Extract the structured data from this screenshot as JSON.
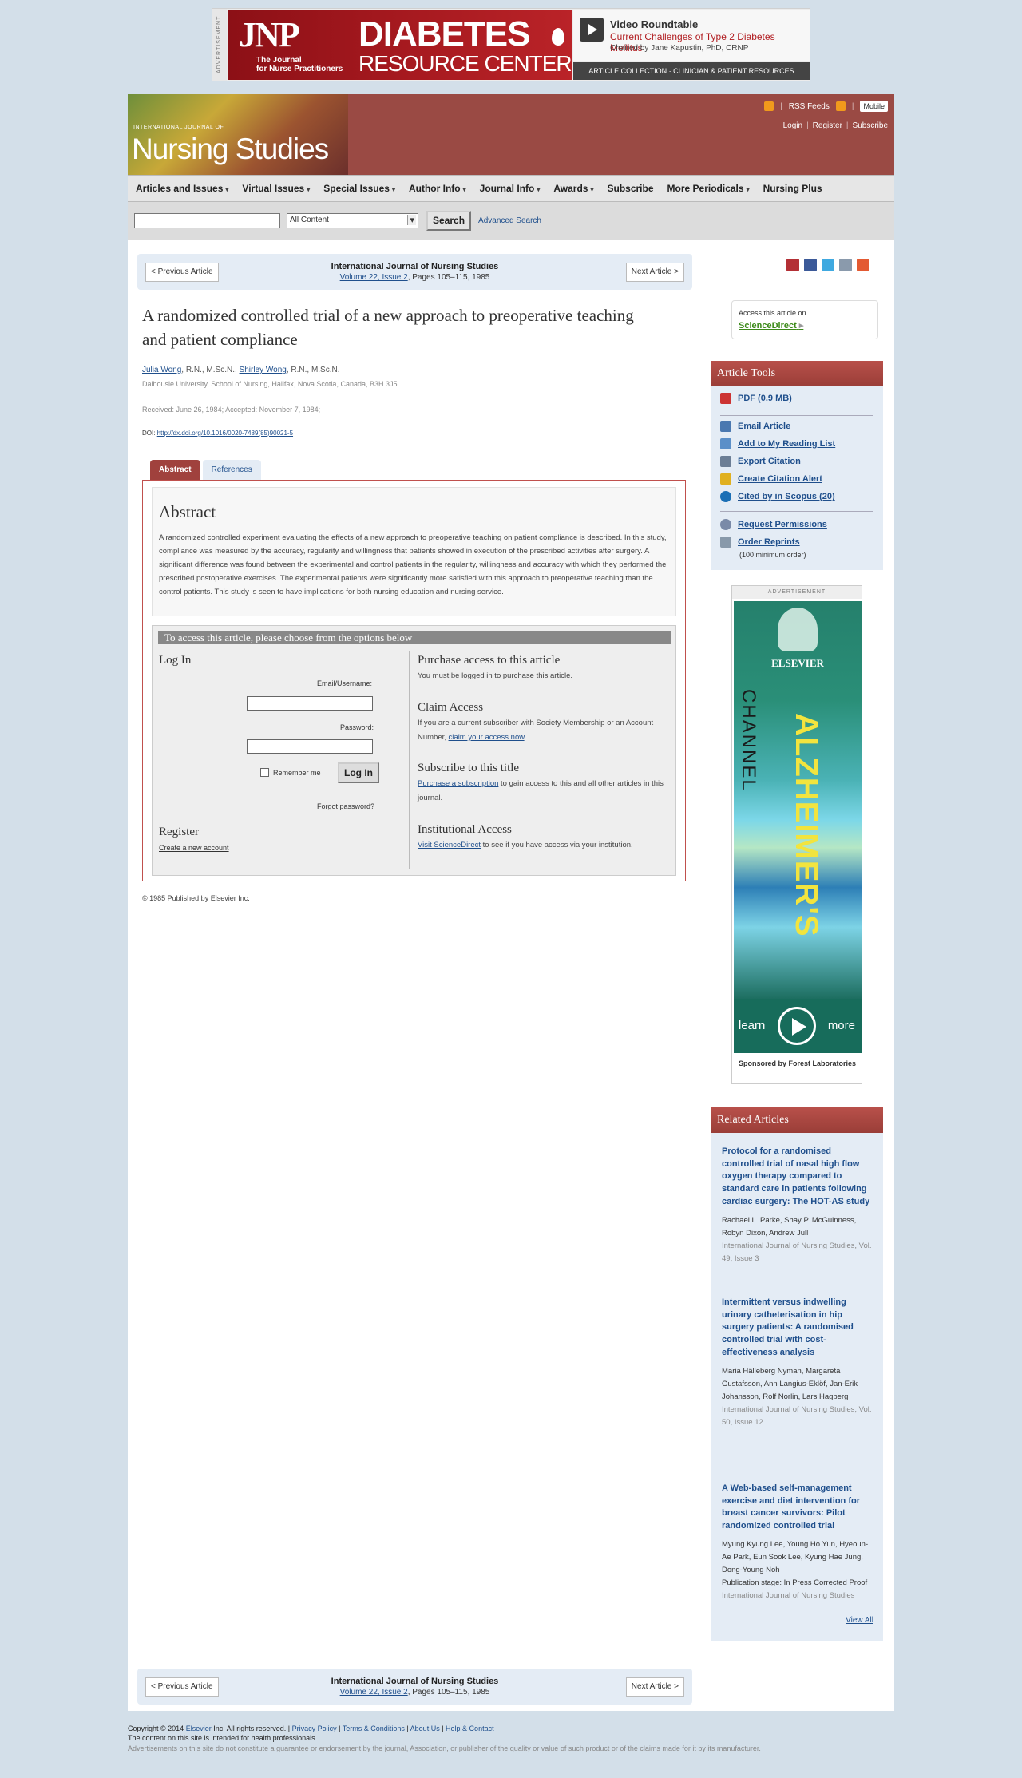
{
  "top_ad": {
    "label": "ADVERTISEMENT",
    "jnp": "JNP",
    "jnp_sub1": "The Journal",
    "jnp_sub2": "for Nurse Practitioners",
    "diabetes": "DIABETES",
    "resource_center": "RESOURCE CENTER",
    "video_title": "Video Roundtable",
    "video_subtitle": "Current Challenges of Type 2 Diabetes Mellitus",
    "chaired": "Chaired by Jane Kapustin, PhD, CRNP",
    "bar_text": "ARTICLE COLLECTION  ·  CLINICIAN & PATIENT RESOURCES"
  },
  "header": {
    "logo_small": "INTERNATIONAL JOURNAL OF",
    "logo_big": "Nursing Studies",
    "rss": "RSS Feeds",
    "mobile": "Mobile",
    "login": "Login",
    "register": "Register",
    "subscribe": "Subscribe"
  },
  "nav": [
    {
      "label": "Articles and Issues",
      "caret": "▾"
    },
    {
      "label": "Virtual Issues",
      "caret": "▾"
    },
    {
      "label": "Special Issues",
      "caret": "▾"
    },
    {
      "label": "Author Info",
      "caret": "▾"
    },
    {
      "label": "Journal Info",
      "caret": "▾"
    },
    {
      "label": "Awards",
      "caret": "▾"
    },
    {
      "label": "Subscribe",
      "caret": ""
    },
    {
      "label": "More Periodicals",
      "caret": "▾"
    },
    {
      "label": "Nursing Plus",
      "caret": ""
    }
  ],
  "search": {
    "select_value": "All Content",
    "button": "Search",
    "advanced": "Advanced Search"
  },
  "article_nav": {
    "prev": "< Previous Article",
    "next": "Next Article >",
    "journal": "International Journal of Nursing Studies",
    "volume_issue": "Volume 22, Issue 2",
    "pages": ", Pages 105–115, 1985"
  },
  "article": {
    "title": "A randomized controlled trial of a new approach to preoperative teaching and patient compliance",
    "author1": "Julia Wong",
    "author1_deg": ", R.N., M.Sc.N., ",
    "author2": "Shirley Wong",
    "author2_deg": ", R.N., M.Sc.N.",
    "affiliation": "Dalhousie University, School of Nursing, Halifax, Nova Scotia, Canada, B3H 3J5",
    "dates": "Received: June 26, 1984; Accepted: November 7, 1984;",
    "doi_label": "DOI: ",
    "doi": "http://dx.doi.org/10.1016/0020-7489(85)90021-5",
    "copyright": "© 1985 Published by Elsevier Inc."
  },
  "tabs": {
    "abstract": "Abstract",
    "references": "References"
  },
  "abstract": {
    "heading": "Abstract",
    "text": "A randomized controlled experiment evaluating the effects of a new approach to preoperative teaching on patient compliance is described. In this study, compliance was measured by the accuracy, regularity and willingness that patients showed in execution of the prescribed activities after surgery. A significant difference was found between the experimental and control patients in the regularity, willingness and accuracy with which they performed the prescribed postoperative exercises. The experimental patients were significantly more satisfied with this approach to preoperative teaching than the control patients. This study is seen to have implications for both nursing education and nursing service."
  },
  "access": {
    "header": "To access this article, please choose from the options below",
    "login_heading": "Log In",
    "email_label": "Email/Username:",
    "password_label": "Password:",
    "remember": "Remember me",
    "login_button": "Log In",
    "forgot": "Forgot password?",
    "register_heading": "Register",
    "create_account": "Create a new account",
    "purchase_heading": "Purchase access to this article",
    "purchase_text": "You must be logged in to purchase this article.",
    "claim_heading": "Claim Access",
    "claim_text": "If you are a current subscriber with Society Membership or an Account Number, ",
    "claim_link": "claim your access now",
    "claim_end": ".",
    "subscribe_heading": "Subscribe to this title",
    "subscribe_link": "Purchase a subscription",
    "subscribe_text": " to gain access to this and all other articles in this journal.",
    "inst_heading": "Institutional Access",
    "inst_link": "Visit ScienceDirect",
    "inst_text": " to see if you have access via your institution."
  },
  "access_sd": {
    "line1": "Access this article on",
    "line2": "ScienceDirect",
    "arrow": "▸"
  },
  "tools": {
    "heading": "Article Tools",
    "pdf": "PDF (0.9 MB)",
    "email": "Email Article",
    "reading_list": "Add to My Reading List",
    "export": "Export Citation",
    "alert": "Create Citation Alert",
    "scopus": "Cited by in Scopus (20)",
    "permissions": "Request Permissions",
    "reprints": "Order Reprints",
    "reprints_sub": "(100 minimum order)"
  },
  "side_ad": {
    "label": "ADVERTISEMENT",
    "elsevier": "ELSEVIER",
    "channel": "CHANNEL",
    "alzheimers": "ALZHEIMER'S",
    "learn": "learn",
    "more": "more",
    "sponsor": "Sponsored by Forest Laboratories"
  },
  "related": {
    "heading": "Related Articles",
    "items": [
      {
        "title": "Protocol for a randomised controlled trial of nasal high flow oxygen therapy compared to standard care in patients following cardiac surgery: The HOT-AS study",
        "authors": "Rachael L. Parke, Shay P. McGuinness, Robyn Dixon, Andrew Jull",
        "journal": "International Journal of Nursing Studies, Vol. 49, Issue 3"
      },
      {
        "title": "Intermittent versus indwelling urinary catheterisation in hip surgery patients: A randomised controlled trial with cost-effectiveness analysis",
        "authors": "Maria Hälleberg Nyman, Margareta Gustafsson, Ann Langius-Eklöf, Jan-Erik Johansson, Rolf Norlin, Lars Hagberg",
        "journal": "International Journal of Nursing Studies, Vol. 50, Issue 12"
      },
      {
        "title": "A Web-based self-management exercise and diet intervention for breast cancer survivors: Pilot randomized controlled trial",
        "authors": "Myung Kyung Lee, Young Ho Yun, Hyeoun-Ae Park, Eun Sook Lee, Kyung Hae Jung, Dong-Young Noh",
        "journal": "Publication stage: In Press Corrected Proof",
        "journal2": "International Journal of Nursing Studies"
      }
    ],
    "view_all": "View All"
  },
  "footer": {
    "copyright_pre": "Copyright © 2014 ",
    "elsevier": "Elsevier",
    "copyright_post": " Inc. All rights reserved. | ",
    "privacy": "Privacy Policy",
    "sep": " | ",
    "terms": "Terms & Conditions",
    "about": "About Us",
    "help": "Help & Contact",
    "line2": "The content on this site is intended for health professionals.",
    "line3": "Advertisements on this site do not constitute a guarantee or endorsement by the journal, Association, or publisher of the quality or value of such product or of the claims made for it by its manufacturer."
  }
}
